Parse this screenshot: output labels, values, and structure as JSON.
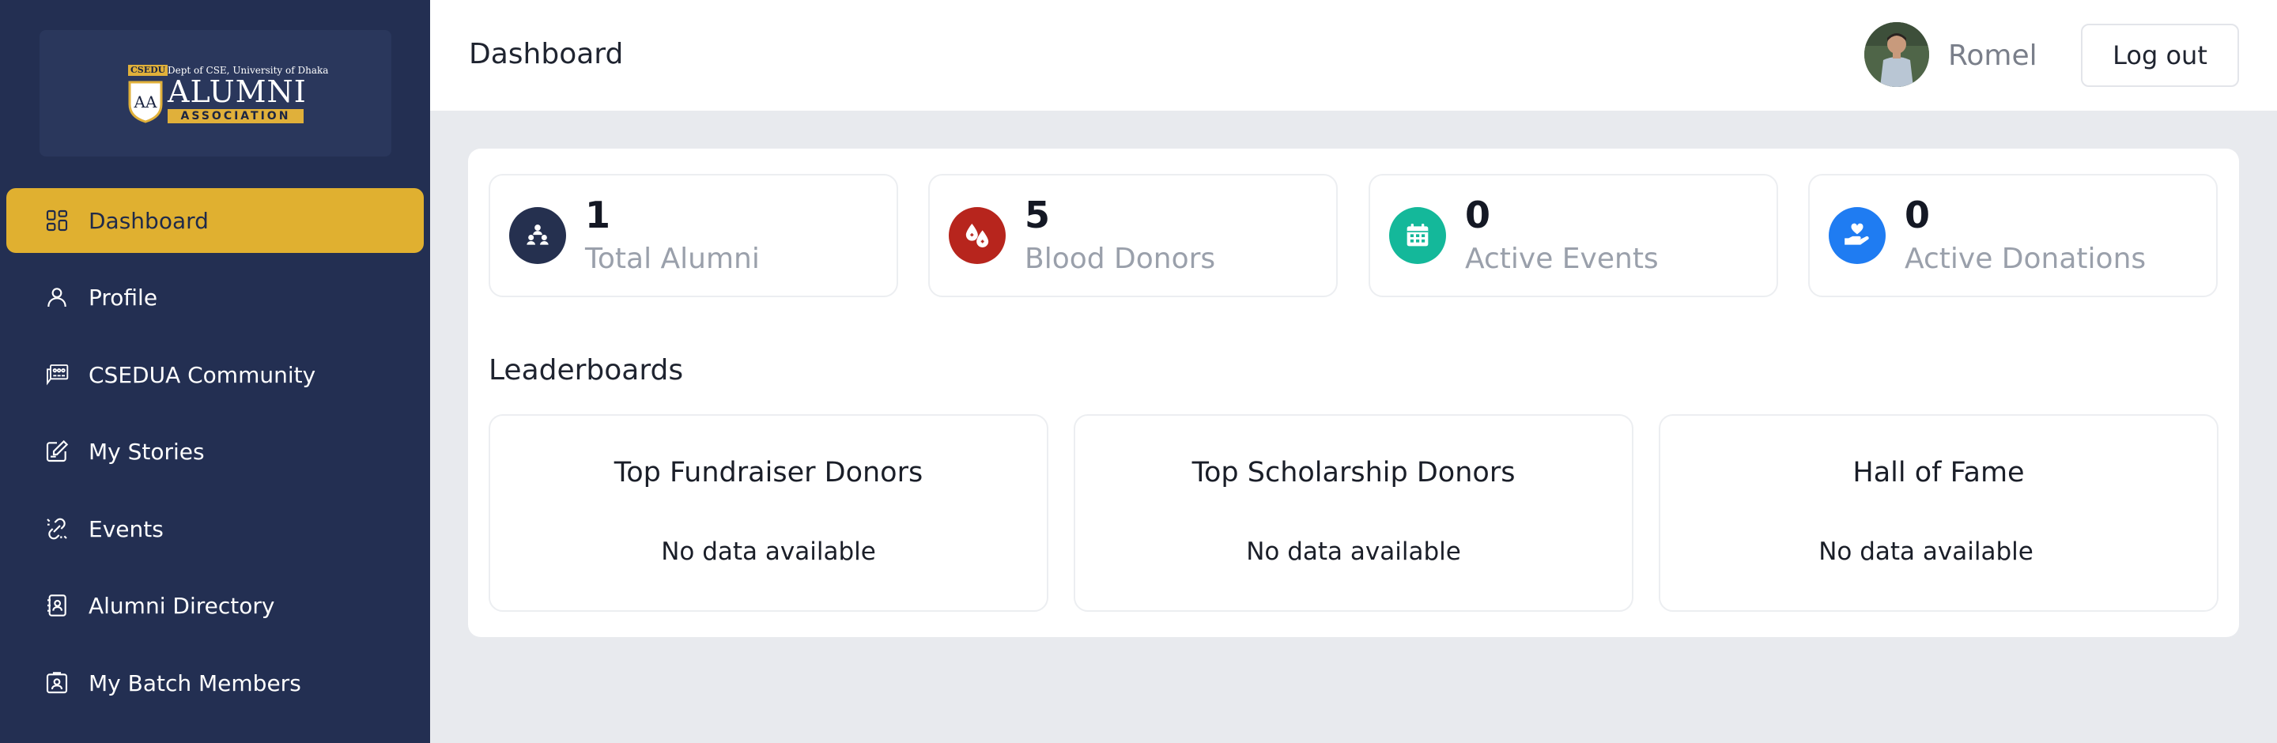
{
  "logo": {
    "tag": "CSEDU",
    "dept_line": "Dept of CSE, University of Dhaka",
    "main_text": "ALUMNI",
    "sub_text": "ASSOCIATION"
  },
  "sidebar": {
    "items": [
      {
        "label": "Dashboard",
        "icon": "dashboard-icon",
        "active": true
      },
      {
        "label": "Profile",
        "icon": "user-icon"
      },
      {
        "label": "CSEDUA Community",
        "icon": "community-icon"
      },
      {
        "label": "My Stories",
        "icon": "edit-icon"
      },
      {
        "label": "Events",
        "icon": "events-icon"
      },
      {
        "label": "Alumni Directory",
        "icon": "contact-book-icon"
      },
      {
        "label": "My Batch Members",
        "icon": "id-badge-icon"
      }
    ]
  },
  "header": {
    "title": "Dashboard",
    "user_name": "Romel",
    "logout_label": "Log out"
  },
  "stats": [
    {
      "value": "1",
      "label": "Total Alumni",
      "icon": "alumni-group-icon",
      "color": "#25304f"
    },
    {
      "value": "5",
      "label": "Blood Donors",
      "icon": "blood-drop-icon",
      "color": "#b7251d"
    },
    {
      "value": "0",
      "label": "Active Events",
      "icon": "calendar-icon",
      "color": "#14b89a"
    },
    {
      "value": "0",
      "label": "Active Donations",
      "icon": "hand-heart-icon",
      "color": "#1f7cf2"
    }
  ],
  "leaderboards": {
    "title": "Leaderboards",
    "cards": [
      {
        "title": "Top Fundraiser Donors",
        "empty": "No data available"
      },
      {
        "title": "Top Scholarship Donors",
        "empty": "No data available"
      },
      {
        "title": "Hall of Fame",
        "empty": "No data available"
      }
    ]
  },
  "colors": {
    "sidebar_bg": "#232f52",
    "active_item": "#e0b030",
    "page_bg": "#e8eaee"
  }
}
